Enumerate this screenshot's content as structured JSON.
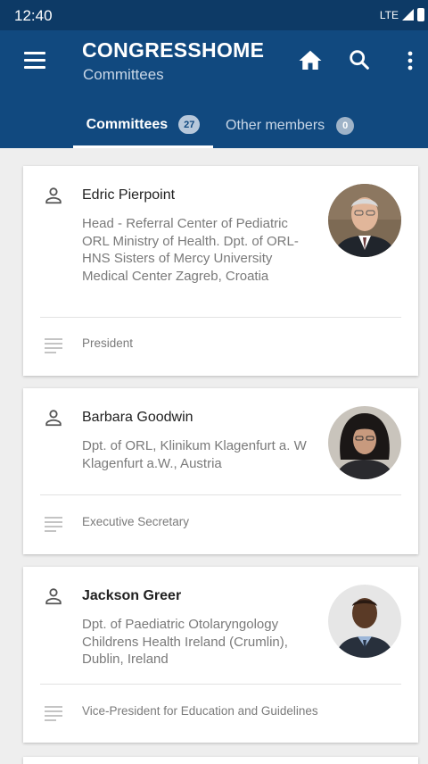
{
  "status_bar": {
    "time": "12:40",
    "network": "LTE"
  },
  "app_bar": {
    "title": "CONGRESSHOME",
    "subtitle": "Committees"
  },
  "tabs": [
    {
      "label": "Committees",
      "count": "27",
      "active": true
    },
    {
      "label": "Other members",
      "count": "0",
      "active": false
    }
  ],
  "members": [
    {
      "name": "Edric Pierpoint",
      "affiliation": "Head - Referral Center of Pediatric ORL Ministry of Health. Dpt. of ORL-HNS Sisters of Mercy University Medical Center Zagreb, Croatia",
      "role": "President"
    },
    {
      "name": "Barbara Goodwin",
      "affiliation": "Dpt. of ORL, Klinikum Klagenfurt a. W Klagenfurt a.W., Austria",
      "role": "Executive Secretary"
    },
    {
      "name": "Jackson Greer",
      "affiliation": "Dpt. of Paediatric Otolaryngology Childrens Health Ireland (Crumlin), Dublin, Ireland",
      "role": "Vice-President for Education and Guidelines"
    }
  ],
  "colors": {
    "app_bar": "#11497f",
    "status_bar": "#0d3a66",
    "background": "#eeeeee"
  },
  "icons": [
    "menu-icon",
    "home-icon",
    "search-icon",
    "more-vert-icon",
    "person-icon",
    "notes-icon"
  ]
}
